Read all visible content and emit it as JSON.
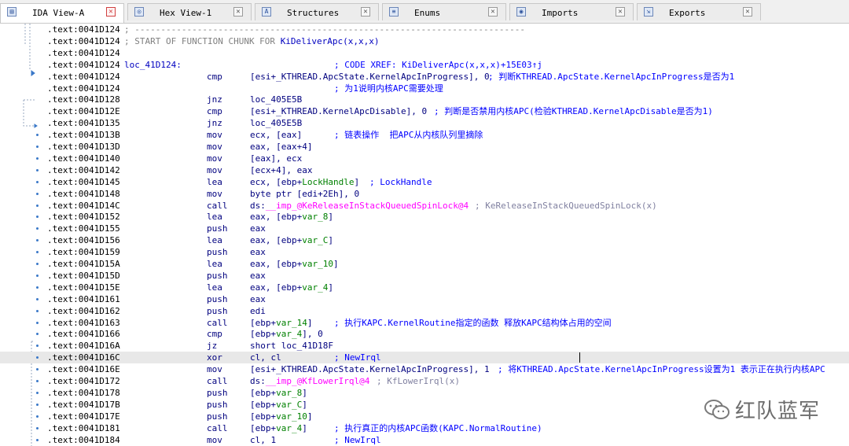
{
  "tabs": [
    {
      "label": "IDA View-A",
      "icon": "ida-view-icon",
      "active": true
    },
    {
      "label": "Hex View-1",
      "icon": "hex-icon",
      "active": false
    },
    {
      "label": "Structures",
      "icon": "structures-icon",
      "active": false
    },
    {
      "label": "Enums",
      "icon": "enums-icon",
      "active": false
    },
    {
      "label": "Imports",
      "icon": "imports-icon",
      "active": false
    },
    {
      "label": "Exports",
      "icon": "exports-icon",
      "active": false
    }
  ],
  "lines": [
    {
      "addr": ".text:0041D124",
      "sep": "; ---------------------------------------------------------------------------"
    },
    {
      "addr": ".text:0041D124",
      "sep": "; START OF FUNCTION CHUNK FOR ",
      "sepfunc": "KiDeliverApc(x,x,x)"
    },
    {
      "addr": ".text:0041D124"
    },
    {
      "addr": ".text:0041D124",
      "label": "loc_41D124:",
      "comment": "; CODE XREF: KiDeliverApc(x,x,x)+15E03↑j",
      "ccol": 425
    },
    {
      "addr": ".text:0041D124",
      "mnem": "cmp",
      "ops": "[esi+_KTHREAD.ApcState.KernelApcInProgress], 0",
      "comment": "; 判断KTHREAD.ApcState.KernelApcInProgress是否为1",
      "ccol": 621
    },
    {
      "addr": ".text:0041D124",
      "comment": "; 为1说明内核APC需要处理",
      "ccol": 425
    },
    {
      "addr": ".text:0041D128",
      "mnem": "jnz",
      "ops": "loc_405E5B"
    },
    {
      "addr": ".text:0041D12E",
      "mnem": "cmp",
      "ops": "[esi+_KTHREAD.KernelApcDisable], 0",
      "comment": "; 判断是否禁用内核APC(检验KTHREAD.KernelApcDisable是否为1)",
      "ccol": 552
    },
    {
      "addr": ".text:0041D135",
      "mnem": "jnz",
      "ops": "loc_405E5B"
    },
    {
      "addr": ".text:0041D13B",
      "mnem": "mov",
      "ops": "ecx, [eax]",
      "comment": "; 链表操作  把APC从内核队列里摘除",
      "ccol": 425
    },
    {
      "addr": ".text:0041D13D",
      "mnem": "mov",
      "ops": "eax, [eax+4]"
    },
    {
      "addr": ".text:0041D140",
      "mnem": "mov",
      "ops": "[eax], ecx"
    },
    {
      "addr": ".text:0041D142",
      "mnem": "mov",
      "ops": "[ecx+4], eax"
    },
    {
      "addr": ".text:0041D145",
      "mnem": "lea",
      "ops": "ecx, [ebp+LockHandle]",
      "comment": "; LockHandle",
      "ccol": 470
    },
    {
      "addr": ".text:0041D148",
      "mnem": "mov",
      "ops": "byte ptr [edi+2Eh], 0"
    },
    {
      "addr": ".text:0041D14C",
      "mnem": "call",
      "ops": "ds:__imp_@KeReleaseInStackQueuedSpinLock@4",
      "comment": "; KeReleaseInStackQueuedSpinLock(x)",
      "ccol": 604,
      "gray": true
    },
    {
      "addr": ".text:0041D152",
      "mnem": "lea",
      "ops": "eax, [ebp+var_8]"
    },
    {
      "addr": ".text:0041D155",
      "mnem": "push",
      "ops": "eax"
    },
    {
      "addr": ".text:0041D156",
      "mnem": "lea",
      "ops": "eax, [ebp+var_C]"
    },
    {
      "addr": ".text:0041D159",
      "mnem": "push",
      "ops": "eax"
    },
    {
      "addr": ".text:0041D15A",
      "mnem": "lea",
      "ops": "eax, [ebp+var_10]"
    },
    {
      "addr": ".text:0041D15D",
      "mnem": "push",
      "ops": "eax"
    },
    {
      "addr": ".text:0041D15E",
      "mnem": "lea",
      "ops": "eax, [ebp+var_4]"
    },
    {
      "addr": ".text:0041D161",
      "mnem": "push",
      "ops": "eax"
    },
    {
      "addr": ".text:0041D162",
      "mnem": "push",
      "ops": "edi"
    },
    {
      "addr": ".text:0041D163",
      "mnem": "call",
      "ops": "[ebp+var_14]",
      "comment": "; 执行KAPC.KernelRoutine指定的函数 释放KAPC结构体占用的空间",
      "ccol": 425
    },
    {
      "addr": ".text:0041D166",
      "mnem": "cmp",
      "ops": "[ebp+var_4], 0"
    },
    {
      "addr": ".text:0041D16A",
      "mnem": "jz",
      "ops": "short loc_41D18F"
    },
    {
      "addr": ".text:0041D16C",
      "mnem": "xor",
      "ops": "cl, cl",
      "comment": "; NewIrql",
      "ccol": 425,
      "selected": true
    },
    {
      "addr": ".text:0041D16E",
      "mnem": "mov",
      "ops": "[esi+_KTHREAD.ApcState.KernelApcInProgress], 1",
      "comment": "; 将KTHREAD.ApcState.KernelApcInProgress设置为1 表示正在执行内核APC",
      "ccol": 633
    },
    {
      "addr": ".text:0041D172",
      "mnem": "call",
      "ops": "ds:__imp_@KfLowerIrql@4",
      "comment": "; KfLowerIrql(x)",
      "ccol": 479,
      "gray": true
    },
    {
      "addr": ".text:0041D178",
      "mnem": "push",
      "ops": "[ebp+var_8]"
    },
    {
      "addr": ".text:0041D17B",
      "mnem": "push",
      "ops": "[ebp+var_C]"
    },
    {
      "addr": ".text:0041D17E",
      "mnem": "push",
      "ops": "[ebp+var_10]"
    },
    {
      "addr": ".text:0041D181",
      "mnem": "call",
      "ops": "[ebp+var_4]",
      "comment": "; 执行真正的内核APC函数(KAPC.NormalRoutine)",
      "ccol": 425
    },
    {
      "addr": ".text:0041D184",
      "mnem": "mov",
      "ops": "cl, 1",
      "comment": "; NewIrql",
      "ccol": 425
    }
  ],
  "watermark": {
    "text": "红队蓝军"
  }
}
